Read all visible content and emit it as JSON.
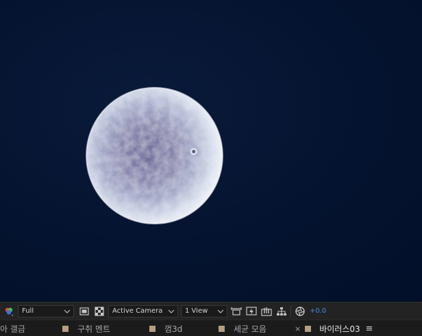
{
  "viewer": {
    "background_color": "#041430",
    "subject": "sphere"
  },
  "toolbar": {
    "resolution": "Full",
    "camera": "Active Camera",
    "views": "1 View",
    "exposure_offset": "+0.0"
  },
  "tabs": [
    {
      "label": "아 갤금",
      "swatch_color": "#b59f7e",
      "active": false
    },
    {
      "label": "구취 멘트",
      "swatch_color": "#b59f7e",
      "active": false
    },
    {
      "label": "껌3d",
      "swatch_color": "#b59f7e",
      "active": false
    },
    {
      "label": "세균 모음",
      "swatch_color": "#b59f7e",
      "active": false
    },
    {
      "label": "바이러스03",
      "swatch_color": "#b59f7e",
      "active": true,
      "closable": true
    }
  ],
  "colors": {
    "accent_blue": "#3c8ee8",
    "panel_bg": "#232323",
    "tab_bg": "#1b1b1b"
  }
}
